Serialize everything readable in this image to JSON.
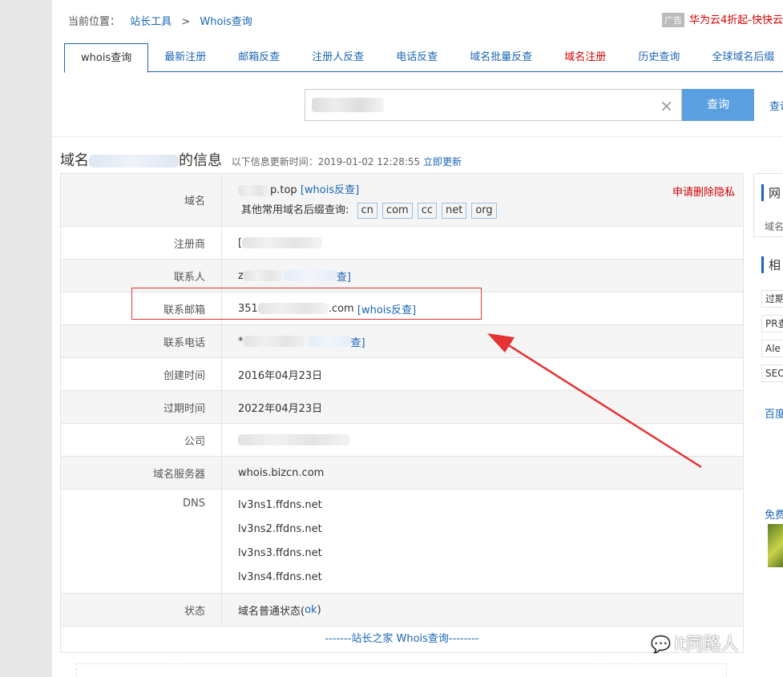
{
  "breadcrumb": {
    "prefix": "当前位置：",
    "item1": "站长工具",
    "sep": ">",
    "item2": "Whois查询"
  },
  "ad": {
    "badge": "广告",
    "text": "华为云4折起-快快云"
  },
  "tabs": [
    {
      "label": "whois查询"
    },
    {
      "label": "最新注册"
    },
    {
      "label": "邮箱反查"
    },
    {
      "label": "注册人反查"
    },
    {
      "label": "电话反查"
    },
    {
      "label": "域名批量反查"
    },
    {
      "label": "域名注册"
    },
    {
      "label": "历史查询"
    },
    {
      "label": "全球域名后缀"
    }
  ],
  "search": {
    "button": "查询",
    "link": "查询",
    "clear": "×"
  },
  "info": {
    "title_prefix": "域名",
    "title_suffix": "的信息",
    "update_label": "以下信息更新时间：2019-01-02 12:28:55",
    "update_link": "立即更新"
  },
  "rows": {
    "domain": {
      "label": "域名",
      "value": "p.top",
      "link": "[whois反查]",
      "delete": "申请删除隐私",
      "suffix_label": "其他常用域名后缀查询:",
      "suffixes": [
        "cn",
        "com",
        "cc",
        "net",
        "org"
      ]
    },
    "registrar": {
      "label": "注册商",
      "value": "["
    },
    "contact": {
      "label": "联系人",
      "value": "z",
      "link": "查]"
    },
    "email": {
      "label": "联系邮箱",
      "value_start": "351",
      "value_end": ".com",
      "link": "[whois反查]"
    },
    "phone": {
      "label": "联系电话",
      "value": "*",
      "link": "查]"
    },
    "created": {
      "label": "创建时间",
      "value": "2016年04月23日"
    },
    "expires": {
      "label": "过期时间",
      "value": "2022年04月23日"
    },
    "company": {
      "label": "公司"
    },
    "server": {
      "label": "域名服务器",
      "value": "whois.bizcn.com"
    },
    "dns": {
      "label": "DNS",
      "values": [
        "lv3ns1.ffdns.net",
        "lv3ns2.ffdns.net",
        "lv3ns3.ffdns.net",
        "lv3ns4.ffdns.net"
      ]
    },
    "status": {
      "label": "状态",
      "value": "域名普通状态(",
      "code": "ok",
      "close": ")"
    }
  },
  "footer": "-------站长之家 Whois查询--------",
  "sidebar": {
    "h1": "网",
    "s1": "域名",
    "h2": "相",
    "b1": "过期",
    "b2": "PR查",
    "b3": "Ale",
    "b4": "SEO",
    "l1": "百度",
    "l2": "免费"
  },
  "watermark": "it同路人",
  "colors": {
    "link": "#1a66b3",
    "button": "#5aa0e0",
    "alert": "#d40000",
    "annotation": "#e53333"
  }
}
